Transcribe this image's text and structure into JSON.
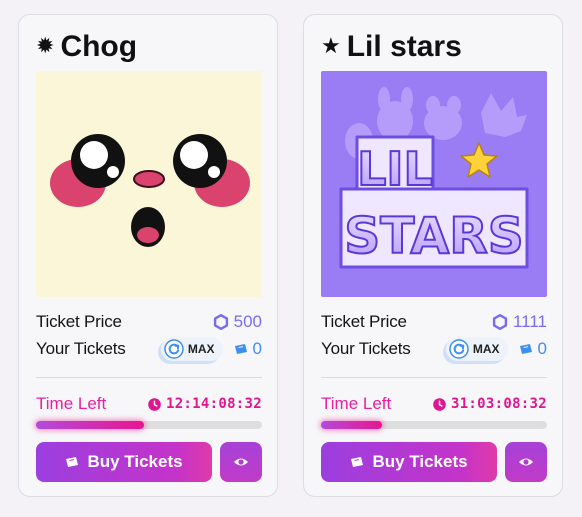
{
  "collections": [
    {
      "title": "Chog",
      "title_icon": "mascot-icon",
      "art": "chog-face-artwork",
      "price_label": "Ticket Price",
      "price_value": "500",
      "price_icon": "hexagon-token-icon",
      "tickets_label": "Your Tickets",
      "max_label": "MAX",
      "tickets_value": "0",
      "time_label": "Time Left",
      "time_value": "12:14:08:32",
      "time_progress": 0.48,
      "buy_label": "Buy Tickets"
    },
    {
      "title": "Lil stars",
      "title_icon": "star-icon",
      "art": "lil-stars-logo-artwork",
      "art_text": [
        "LIL",
        "STARS"
      ],
      "price_label": "Ticket Price",
      "price_value": "1111",
      "price_icon": "hexagon-token-icon",
      "tickets_label": "Your Tickets",
      "max_label": "MAX",
      "tickets_value": "0",
      "time_label": "Time Left",
      "time_value": "31:03:08:32",
      "time_progress": 0.27,
      "buy_label": "Buy Tickets"
    }
  ],
  "colors": {
    "price": "#7a6cf0",
    "tickets": "#3d8ff0",
    "time": "#ec1fa0",
    "button_start": "#9b3fe0",
    "button_end": "#e03aa8",
    "chog_bg": "#fcf6d8",
    "lilstars_bg": "#9a7cf4"
  }
}
